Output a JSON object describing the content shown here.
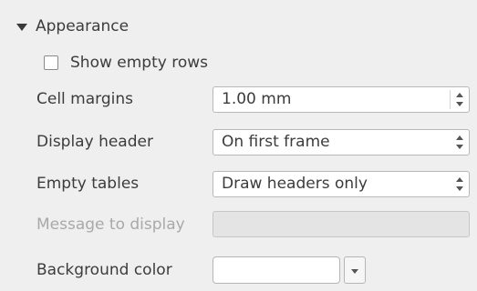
{
  "section": {
    "title": "Appearance",
    "expanded": true,
    "toggle_icon": "triangle-down"
  },
  "show_empty_rows": {
    "label": "Show empty rows",
    "checked": false
  },
  "cell_margins": {
    "label": "Cell margins",
    "value": "1.00 mm"
  },
  "display_header": {
    "label": "Display header",
    "value": "On first frame"
  },
  "empty_tables": {
    "label": "Empty tables",
    "value": "Draw headers only"
  },
  "message_to_display": {
    "label": "Message to display",
    "value": "",
    "enabled": false
  },
  "background_color": {
    "label": "Background color",
    "color": "#ffffff",
    "dropdown_icon": "chevron-down"
  }
}
